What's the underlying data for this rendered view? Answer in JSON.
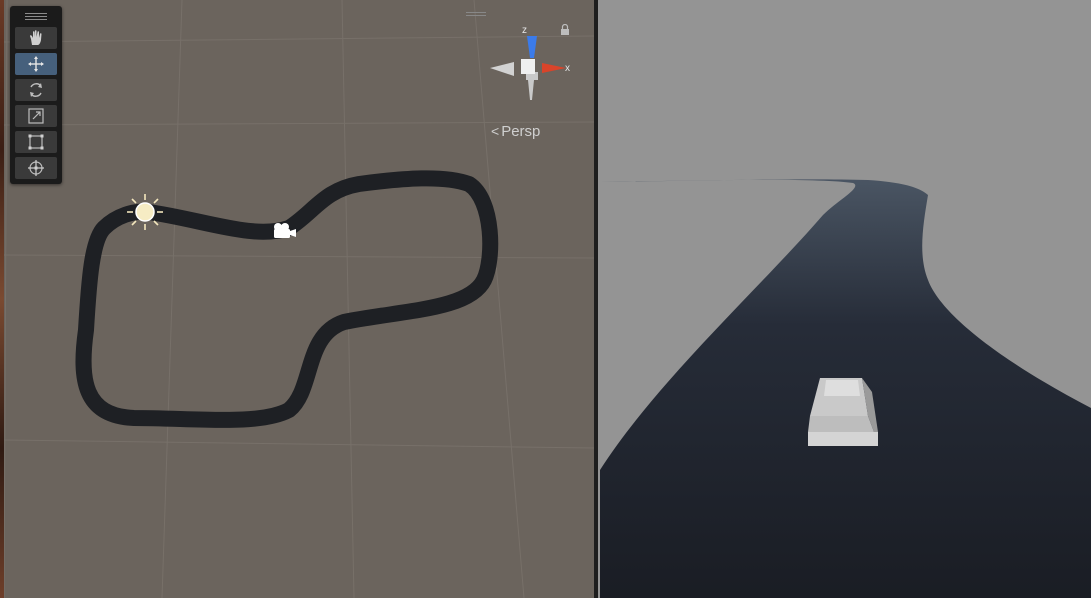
{
  "scene_view": {
    "tools": [
      {
        "name": "hand",
        "icon": "hand-icon",
        "active": false
      },
      {
        "name": "move",
        "icon": "move-icon",
        "active": true
      },
      {
        "name": "rotate",
        "icon": "rotate-icon",
        "active": false
      },
      {
        "name": "scale",
        "icon": "scale-icon",
        "active": false
      },
      {
        "name": "rect",
        "icon": "rect-transform-icon",
        "active": false
      },
      {
        "name": "transform",
        "icon": "transform-icon",
        "active": false
      }
    ],
    "gizmo": {
      "z_label": "z",
      "x_label": "x",
      "projection_label": "Persp",
      "x_color": "#d9442a",
      "z_color": "#3b7bea"
    },
    "icons": [
      "sun-icon",
      "camera-icon"
    ]
  },
  "game_view": {
    "sky_color": "#949494",
    "road_color": "#202530"
  },
  "colors": {
    "scene_bg": "#6b645d",
    "track": "#1e2024",
    "active_tool": "#46607c"
  }
}
